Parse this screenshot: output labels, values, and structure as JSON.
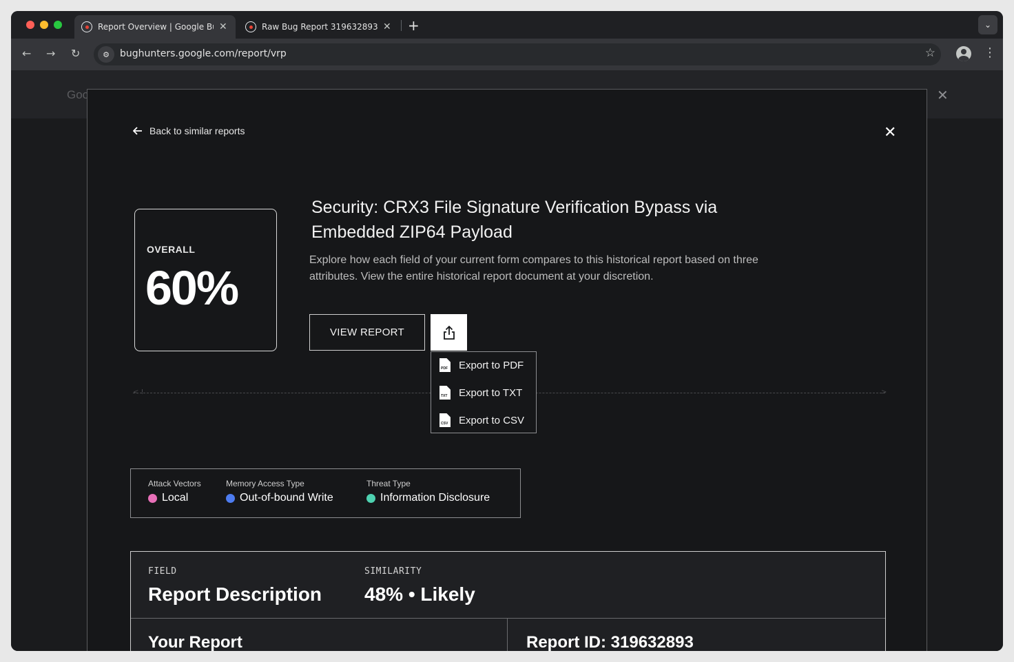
{
  "browser": {
    "tabs": [
      {
        "title": "Report Overview | Google Bu"
      },
      {
        "title": "Raw Bug Report 319632893"
      }
    ],
    "url": "bughunters.google.com/report/vrp"
  },
  "background": {
    "logo_text": "Goo"
  },
  "modal": {
    "back_label": "Back to similar reports",
    "score": {
      "label": "OVERALL",
      "value": "60%"
    },
    "title": "Security: CRX3 File Signature Verification Bypass via Embedded ZIP64 Payload",
    "description": "Explore how each field of your current form compares to this historical report based on three attributes. View the entire historical report document at your discretion.",
    "view_report_label": "VIEW REPORT",
    "export_menu": [
      {
        "label": "Export to PDF",
        "badge": "PDF"
      },
      {
        "label": "Export to TXT",
        "badge": "TXT"
      },
      {
        "label": "Export to CSV",
        "badge": "CSV"
      }
    ],
    "attributes": [
      {
        "label": "Attack Vectors",
        "value": "Local",
        "color": "#e870b8"
      },
      {
        "label": "Memory Access Type",
        "value": "Out-of-bound Write",
        "color": "#4d7cf0"
      },
      {
        "label": "Threat Type",
        "value": "Information Disclosure",
        "color": "#4ed1b0"
      }
    ],
    "comparison": {
      "field_label": "FIELD",
      "field_value": "Report Description",
      "similarity_label": "SIMILARITY",
      "similarity_value": "48% • Likely",
      "left_heading": "Your Report",
      "right_heading": "Report ID: 319632893"
    }
  }
}
